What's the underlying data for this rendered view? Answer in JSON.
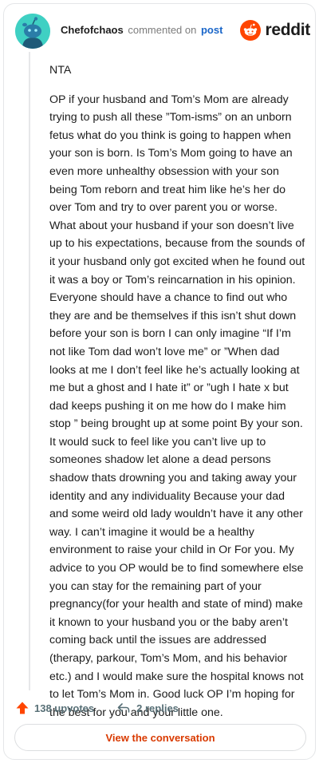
{
  "header": {
    "username": "Chefofchaos",
    "action": "commented on",
    "post_link": "post",
    "logo_text": "reddit"
  },
  "comment": {
    "paragraphs": [
      "NTA",
      "OP if your husband and Tom’s Mom are already trying to push all these ”Tom-isms” on an unborn fetus what do you think is going to happen when your son is born. Is Tom’s Mom going to have an even more unhealthy obsession with your son being Tom reborn and treat him like he’s her do over Tom and try to over parent you or worse. What about your husband if your son doesn’t live up to his expectations, because from the sounds of it your husband only got excited when he found out it was a boy or Tom’s reincarnation in his opinion. Everyone should have a chance to find out who they are and be themselves if this isn’t shut down before your son is born I can only imagine “If I’m not like Tom dad won’t love me” or ”When dad looks at me I don’t feel like he’s actually looking at me but a ghost and I hate it” or ”ugh I hate x but dad keeps pushing it on me how do I make him stop ” being brought up at some point By your son. It would suck to feel like you can’t live up to someones shadow let alone a dead persons shadow thats drowning you and taking away your identity and any individuality Because your dad and some weird old lady wouldn’t have it any other way. I can’t imagine it would be a healthy environment to raise your child in Or For you. My advice to you OP would be to find somewhere else you can stay for the remaining part of your pregnancy(for your health and state of mind) make it known to your husband you or the baby aren’t coming back until the issues are addressed (therapy, parkour, Tom’s Mom, and his behavior etc.) and I would make sure the hospital knows not to let Tom’s Mom in. Good luck OP I’m hoping for the best for you and your little one."
    ]
  },
  "footer": {
    "upvotes": "138 upvotes",
    "replies": "2 replies",
    "upvote_icon": "upvote-arrow-icon",
    "reply_icon": "reply-arrow-icon"
  },
  "actions": {
    "view_conversation": "View the conversation"
  },
  "colors": {
    "brand": "#ff4500",
    "link": "#1a66c9",
    "muted": "#576f76",
    "cta": "#d93a00",
    "avatar_bg": "#3fd0c3"
  }
}
